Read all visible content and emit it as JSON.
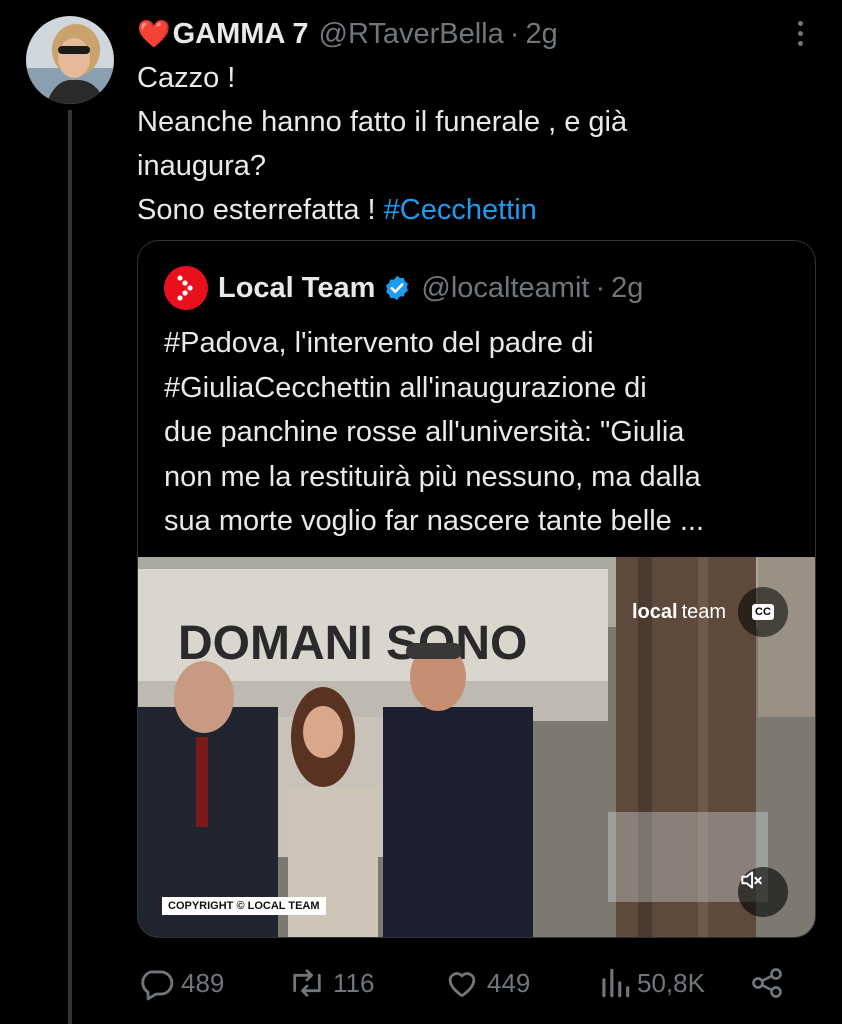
{
  "post": {
    "author_name": "GAMMA 7",
    "author_emoji": "❤️",
    "handle": "@RTaverBella",
    "separator": "·",
    "time": "2g",
    "text_lines": [
      "Cazzo !",
      "Neanche hanno fatto il funerale , e già",
      "inaugura?"
    ],
    "last_line": "Sono esterrefatta !",
    "hashtag": "#Cecchettin"
  },
  "quote": {
    "author_name": "Local Team",
    "handle": "@localteamit",
    "separator": "·",
    "time": "2g",
    "text_lines": [
      "#Padova, l'intervento del padre di",
      "#GiuliaCecchettin all'inaugurazione di",
      "due panchine rosse all'università: \"Giulia",
      "non me la restituirà più nessuno, ma dalla",
      "sua morte voglio far nascere tante belle ..."
    ],
    "media": {
      "watermark_brand": "local",
      "watermark_team": "team",
      "cc_label": "CC",
      "copyright": "COPYRIGHT © LOCAL TEAM",
      "banner_text": "DOMANI SONO"
    }
  },
  "actions": {
    "replies": "489",
    "reposts": "116",
    "likes": "449",
    "views": "50,8K"
  },
  "colors": {
    "background": "#000000",
    "text": "#e7e9ea",
    "muted": "#71767b",
    "link": "#1d9bf0",
    "border": "#2f3336",
    "heart": "#e0245e",
    "brand_red": "#e8101d"
  }
}
